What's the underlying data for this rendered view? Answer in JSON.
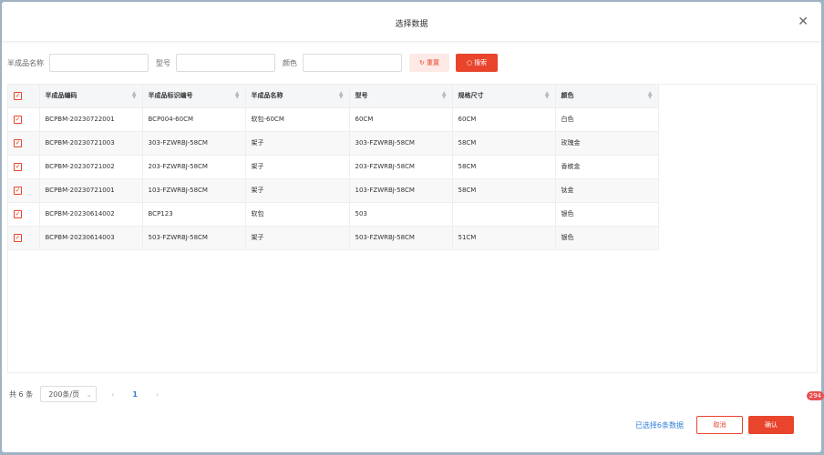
{
  "dialog": {
    "title": "选择数据",
    "close_icon": "close-icon"
  },
  "filters": {
    "name_label": "半成品名称",
    "model_label": "型号",
    "color_label": "颜色",
    "name_value": "",
    "model_value": "",
    "color_value": "",
    "reset_label": "重置",
    "search_label": "搜索"
  },
  "table": {
    "headers": [
      "半成品编码",
      "半成品标识编号",
      "半成品名称",
      "型号",
      "规格尺寸",
      "颜色"
    ],
    "rows": [
      [
        "BCPBM-20230722001",
        "BCP004-60CM",
        "软包-60CM",
        "60CM",
        "60CM",
        "白色"
      ],
      [
        "BCPBM-20230721003",
        "303-FZWRBJ-58CM",
        "架子",
        "303-FZWRBJ-58CM",
        "58CM",
        "玫瑰金"
      ],
      [
        "BCPBM-20230721002",
        "203-FZWRBJ-58CM",
        "架子",
        "203-FZWRBJ-58CM",
        "58CM",
        "香槟金"
      ],
      [
        "BCPBM-20230721001",
        "103-FZWRBJ-58CM",
        "架子",
        "103-FZWRBJ-58CM",
        "58CM",
        "钛金"
      ],
      [
        "BCPBM-20230614002",
        "BCP123",
        "软包",
        "503",
        "",
        "银色"
      ],
      [
        "BCPBM-20230614003",
        "503-FZWRBJ-58CM",
        "架子",
        "503-FZWRBJ-58CM",
        "51CM",
        "银色"
      ]
    ]
  },
  "pagination": {
    "total": "共 6 条",
    "page_size": "200条/页",
    "current_page": "1"
  },
  "footer": {
    "selected": "已选择6条数据",
    "cancel": "取消",
    "confirm": "确认"
  },
  "badge": "294",
  "colors": {
    "accent": "#e8452c",
    "link": "#2f7fd8"
  }
}
